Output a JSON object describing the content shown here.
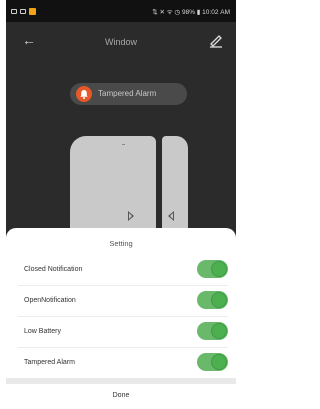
{
  "status_bar": {
    "right_text": "⇅ ✕ ᯤ ◷ 98% ▮ 10:02 AM"
  },
  "top_bar": {
    "title": "Window"
  },
  "device": {
    "alarm_label": "Tampered Alarm"
  },
  "sheet": {
    "title": "Setting",
    "rows": [
      {
        "label": "Closed Notification",
        "enabled": true
      },
      {
        "label": "OpenNotification",
        "enabled": true
      },
      {
        "label": "Low Battery",
        "enabled": true
      },
      {
        "label": "Tampered Alarm",
        "enabled": true
      }
    ],
    "done_label": "Done"
  },
  "colors": {
    "toggle_on": "#4caf50",
    "alarm_icon": "#e6582a",
    "background": "#2b2b2b"
  }
}
